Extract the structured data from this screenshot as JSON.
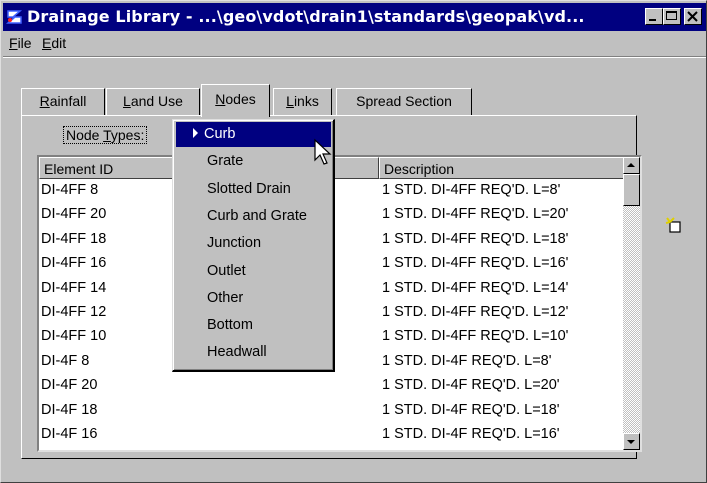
{
  "window": {
    "title": "Drainage Library - ...\\geo\\vdot\\drain1\\standards\\geopak\\vd...",
    "icon": "geopak-app-icon"
  },
  "menu": [
    {
      "label": "File",
      "mnemonic": "F",
      "rest": "ile"
    },
    {
      "label": "Edit",
      "mnemonic": "E",
      "rest": "dit"
    }
  ],
  "tabs": [
    {
      "label": "Rainfall",
      "mnemonic": "R",
      "rest": "ainfall",
      "active": false
    },
    {
      "label": "Land Use",
      "mnemonic": "L",
      "rest": "and Use",
      "active": false
    },
    {
      "label": "Nodes",
      "mnemonic": "N",
      "rest": "odes",
      "active": true
    },
    {
      "label": "Links",
      "mnemonic": "L",
      "rest": "inks",
      "active": false
    },
    {
      "label": "Spread Section",
      "mnemonic": "",
      "rest": "Spread Section",
      "active": false
    }
  ],
  "node_types": {
    "label": "Node Types:",
    "mnemonic": "T",
    "before": "Node ",
    "after": "ypes:"
  },
  "dropdown": {
    "selected_index": 0,
    "options": [
      "Curb",
      "Grate",
      "Slotted Drain",
      "Curb and Grate",
      "Junction",
      "Outlet",
      "Other",
      "Bottom",
      "Headwall"
    ]
  },
  "table": {
    "columns": [
      "Element ID",
      "Description"
    ],
    "rows": [
      {
        "id": "DI-4FF 8",
        "desc": "1 STD. DI-4FF REQ'D. L=8'"
      },
      {
        "id": "DI-4FF 20",
        "desc": "1 STD. DI-4FF REQ'D. L=20'"
      },
      {
        "id": "DI-4FF 18",
        "desc": "1 STD. DI-4FF REQ'D. L=18'"
      },
      {
        "id": "DI-4FF 16",
        "desc": "1 STD. DI-4FF REQ'D. L=16'"
      },
      {
        "id": "DI-4FF 14",
        "desc": "1 STD. DI-4FF REQ'D. L=14'"
      },
      {
        "id": "DI-4FF 12",
        "desc": "1 STD. DI-4FF REQ'D. L=12'"
      },
      {
        "id": "DI-4FF 10",
        "desc": "1 STD. DI-4FF REQ'D. L=10'"
      },
      {
        "id": "DI-4F 8",
        "desc": "1 STD. DI-4F REQ'D. L=8'"
      },
      {
        "id": "DI-4F 20",
        "desc": "1 STD. DI-4F REQ'D. L=20'"
      },
      {
        "id": "DI-4F 18",
        "desc": "1 STD. DI-4F REQ'D. L=18'"
      },
      {
        "id": "DI-4F 16",
        "desc": "1 STD. DI-4F REQ'D. L=16'"
      }
    ]
  },
  "colors": {
    "titlebar": "#000080",
    "face": "#c0c0c0",
    "selection": "#000080",
    "list_bg": "#ffffff"
  },
  "icons": [
    "minimize-icon",
    "maximize-icon",
    "close-icon",
    "new-item-icon",
    "mouse-cursor-icon"
  ]
}
